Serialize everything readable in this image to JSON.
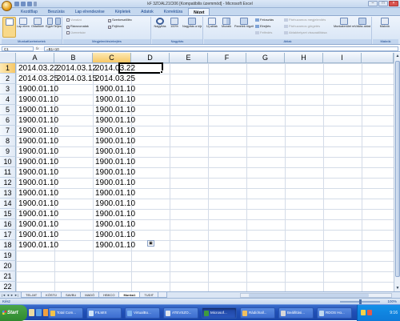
{
  "window": {
    "title": "kF 3ZOAL21Cl06 [Kompatibilis üzemmód] - Microsoft Excel",
    "min": "–",
    "max": "□",
    "close": "×"
  },
  "ribbon_tabs": [
    "Kezdőlap",
    "Beszúrás",
    "Lap elrendezése",
    "Képletek",
    "Adatok",
    "Korrektúra",
    "Nézet"
  ],
  "active_tab": "Nézet",
  "ribbon": {
    "groups": [
      {
        "label": "Munkafüzetnézetek",
        "buttons": [
          "Lap elrendezése",
          "Oldaltöréses megtekintés",
          "Egyéni nézetek",
          "Teljes képernyő"
        ]
      },
      {
        "label": "Megjelenítés/elrejtés",
        "checks": [
          {
            "label": "Vonalzó",
            "checked": false
          },
          {
            "label": "Rácsvonalak",
            "checked": true
          },
          {
            "label": "Üzenetsáv",
            "checked": false
          },
          {
            "label": "Szerkesztőléc",
            "checked": true
          },
          {
            "label": "Fejlécek",
            "checked": true
          }
        ]
      },
      {
        "label": "Nagyítás",
        "buttons": [
          "Nagyítás",
          "100%",
          "Nagyítás a kijelölésre"
        ]
      },
      {
        "label": "Ablak",
        "buttons": [
          "Új ablak",
          "Mozaik",
          "Panelek rögzítése"
        ],
        "rows": [
          "Felosztás",
          "Elrejtés",
          "Felfedés"
        ],
        "rows_disabled": [
          "Párhuzamos megjelenítés",
          "Párhuzamos görgetés",
          "Ablakhelyzet visszaállítása"
        ],
        "extra": [
          "Munkaterület mentése",
          "Váltás ablakra"
        ]
      },
      {
        "label": "Makrók",
        "buttons": [
          "Makrók"
        ]
      }
    ]
  },
  "formula_bar": {
    "name_box": "C1",
    "fx": "fx",
    "formula": "=B1+10"
  },
  "columns": [
    "A",
    "B",
    "C",
    "D",
    "E",
    "F",
    "G",
    "H",
    "I"
  ],
  "selected_column": "C",
  "rows": [
    [
      "2014.03.22",
      "2014.03.12",
      "2014.03.22"
    ],
    [
      "2014.03.25",
      "2014.03.15",
      "2014.03.25"
    ],
    [
      "1900.01.10",
      "",
      "1900.01.10"
    ],
    [
      "1900.01.10",
      "",
      "1900.01.10"
    ],
    [
      "1900.01.10",
      "",
      "1900.01.10"
    ],
    [
      "1900.01.10",
      "",
      "1900.01.10"
    ],
    [
      "1900.01.10",
      "",
      "1900.01.10"
    ],
    [
      "1900.01.10",
      "",
      "1900.01.10"
    ],
    [
      "1900.01.10",
      "",
      "1900.01.10"
    ],
    [
      "1900.01.10",
      "",
      "1900.01.10"
    ],
    [
      "1900.01.10",
      "",
      "1900.01.10"
    ],
    [
      "1900.01.10",
      "",
      "1900.01.10"
    ],
    [
      "1900.01.10",
      "",
      "1900.01.10"
    ],
    [
      "1900.01.10",
      "",
      "1900.01.10"
    ],
    [
      "1900.01.10",
      "",
      "1900.01.10"
    ],
    [
      "1900.01.10",
      "",
      "1900.01.10"
    ],
    [
      "1900.01.10",
      "",
      "1900.01.10"
    ],
    [
      "1900.01.10",
      "",
      "1900.01.10"
    ]
  ],
  "row_numbers": [
    "1",
    "2",
    "3",
    "4",
    "5",
    "6",
    "7",
    "8",
    "9",
    "10",
    "11",
    "12",
    "13",
    "14",
    "15",
    "16",
    "17",
    "18",
    "19",
    "20",
    "21",
    "22"
  ],
  "selected_row": "1",
  "autofill_icon": "autofill-options-icon",
  "sheet_nav": [
    "|◄",
    "◄",
    "►",
    "►|"
  ],
  "sheets": [
    "TELJAT",
    "KÓSTÜ",
    "SAVBU",
    "MADÓ",
    "HBKCO",
    "Munka1",
    "TUDIT"
  ],
  "active_sheet": "Munka1",
  "status": {
    "ready": "Kész",
    "zoom": "100%"
  },
  "taskbar": {
    "start": "Start",
    "buttons": [
      "Total Com...",
      "FILMIX",
      "VirtualBo...",
      "ATEVSZO...",
      "Microsof...",
      "Rádióhall...",
      "Beállítási...",
      "RDOS Ho..."
    ],
    "active": "Microsof...",
    "clock": "9:16"
  }
}
